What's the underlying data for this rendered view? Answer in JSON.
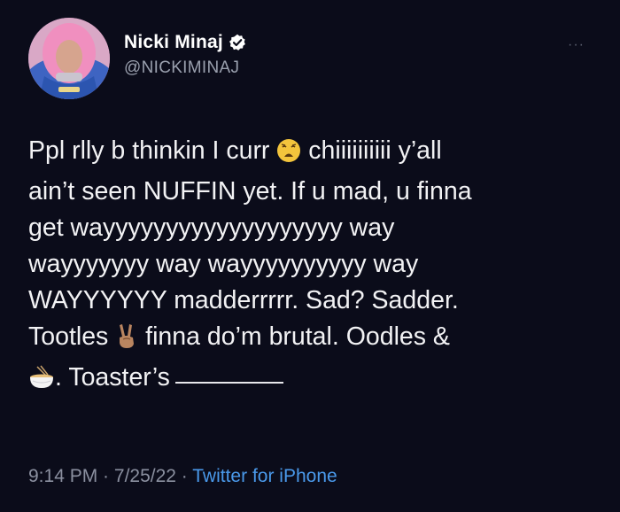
{
  "user": {
    "display_name": "Nicki Minaj",
    "handle": "@NICKIMINAJ",
    "verified": true
  },
  "menu": {
    "more_label": "···"
  },
  "tweet": {
    "line1_a": "Ppl rlly b thinkin I curr",
    "line1_b": "chiiiiiiiiii y’all",
    "line2": "ain’t seen NUFFIN yet. If u mad, u finna",
    "line3": "get wayyyyyyyyyyyyyyyyyyy way",
    "line4": "wayyyyyyy way wayyyyyyyyyy way",
    "line5": "WAYYYYYY madderrrrr. Sad? Sadder.",
    "line6_a": "Tootles",
    "line6_b": "finna do’m brutal. Oodles &",
    "line7": ". Toaster’s",
    "emojis": [
      "weary-face-emoji",
      "victory-hand-emoji",
      "noodle-bowl-emoji"
    ]
  },
  "meta": {
    "time": "9:14 PM",
    "sep1": " · ",
    "date": "7/25/22",
    "sep2": " · ",
    "source": "Twitter for iPhone"
  },
  "colors": {
    "background": "#0b0c1a",
    "text": "#f2f2f4",
    "muted": "#8b90a0",
    "link": "#4a99ea"
  }
}
